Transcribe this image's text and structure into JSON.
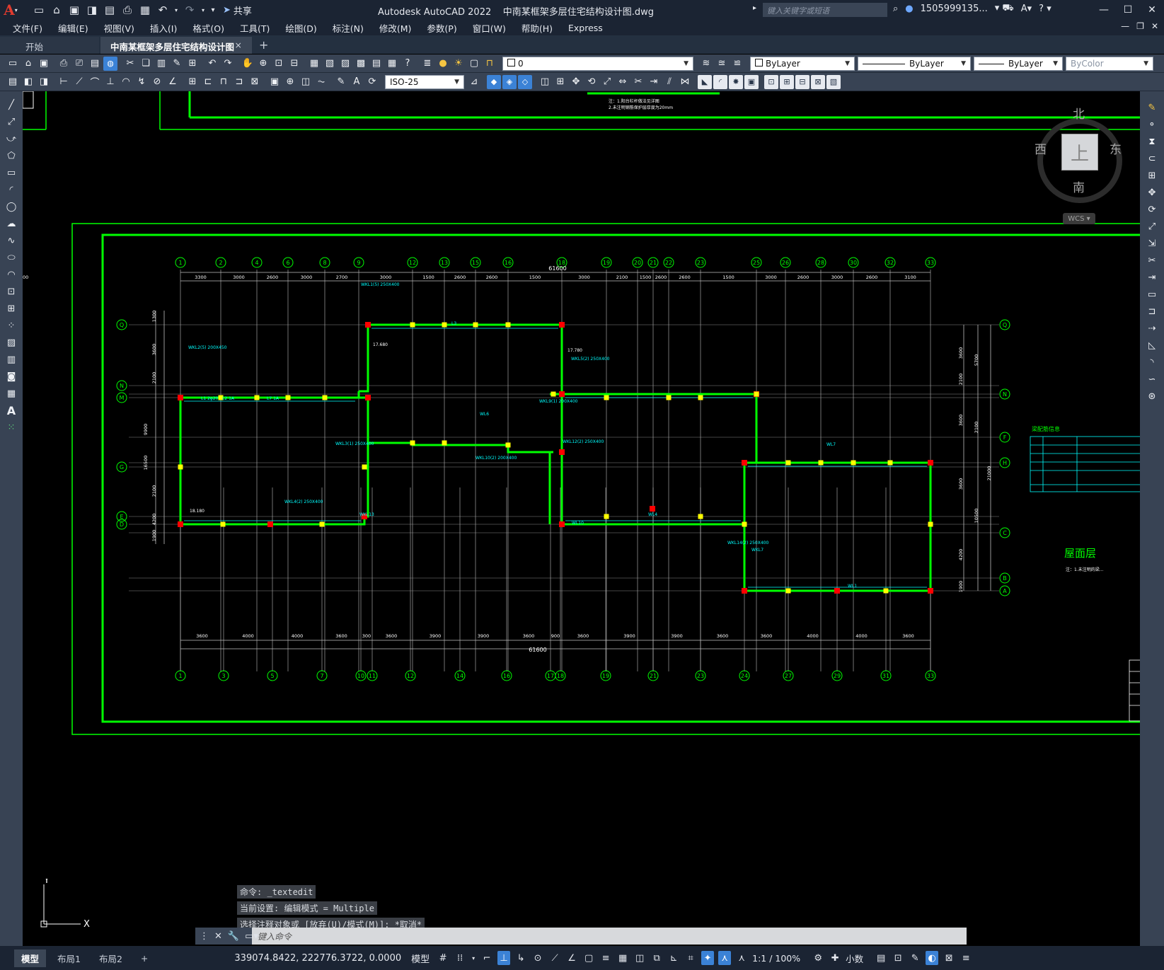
{
  "titlebar": {
    "app_logo": "A",
    "window_title": "Autodesk AutoCAD 2022    中南某框架多层住宅结构设计图.dwg",
    "share_label": "共享",
    "search_placeholder": "键入关键字或短语",
    "user": "1505999135...",
    "controls": [
      "—",
      "☐",
      "✕"
    ]
  },
  "menu": {
    "items": [
      "文件(F)",
      "编辑(E)",
      "视图(V)",
      "插入(I)",
      "格式(O)",
      "工具(T)",
      "绘图(D)",
      "标注(N)",
      "修改(M)",
      "参数(P)",
      "窗口(W)",
      "帮助(H)",
      "Express"
    ]
  },
  "filetabs": {
    "start": "开始",
    "active": "中南某框架多层住宅结构设计图*",
    "close": "×",
    "plus": "+"
  },
  "toolbar": {
    "layer_name": "0",
    "color": "ByLayer",
    "linetype": "ByLayer",
    "lineweight": "ByLayer",
    "plotstyle": "ByColor",
    "dimstyle": "ISO-25"
  },
  "viewcube": {
    "north": "北",
    "south": "南",
    "east": "东",
    "west": "西",
    "face": "上",
    "wcs": "WCS"
  },
  "drawing": {
    "top_note_1": "注：1.阳台栏杆做法见详图",
    "top_note_2": "2.未注明钢筋保护层厚度为20mm",
    "overall_dim_top": "61600",
    "overall_dim_bottom": "61600",
    "top_axes": [
      "1",
      "2",
      "4",
      "6",
      "8",
      "9",
      "12",
      "13",
      "15",
      "16",
      "18",
      "19",
      "20",
      "21",
      "22",
      "23",
      "25",
      "26",
      "28",
      "30",
      "32",
      "33"
    ],
    "bottom_axes": [
      "1",
      "3",
      "5",
      "7",
      "10",
      "11",
      "12",
      "14",
      "16",
      "17",
      "18",
      "19",
      "21",
      "23",
      "24",
      "27",
      "29",
      "31",
      "33"
    ],
    "top_dims": [
      "3300",
      "3000",
      "2600",
      "3000",
      "2700",
      "3000",
      "1500",
      "2600",
      "2600",
      "1500",
      "3000",
      "2100",
      "1500",
      "2600",
      "2600",
      "1500",
      "3000",
      "2600",
      "3000",
      "2600",
      "3100",
      "3300"
    ],
    "bottom_dims": [
      "3600",
      "4000",
      "4000",
      "3600",
      "300",
      "3600",
      "3900",
      "3900",
      "3600",
      "900",
      "3600",
      "3900",
      "3900",
      "3600",
      "3600",
      "4000",
      "4000",
      "3600"
    ],
    "left_axes": [
      "Q",
      "N",
      "M",
      "G",
      "E",
      "D"
    ],
    "right_axes": [
      "Q",
      "N",
      "F",
      "H",
      "C",
      "B",
      "A"
    ],
    "left_dims": [
      "1300",
      "3600",
      "2100",
      "9900",
      "16500",
      "2100",
      "4200",
      "1900"
    ],
    "right_dims": [
      "3600",
      "5700",
      "2100",
      "3600",
      "21000",
      "2100",
      "3600",
      "10500",
      "4200",
      "1900"
    ],
    "beam_labels": [
      "WKL2(5) 200X450",
      "WKL1(5) 250X400",
      "WKL5(2) 250X400",
      "WKL4(2) 250X400",
      "WKL3(1) 250X400",
      "WKL9(1) 200X400",
      "WKL10(2) 200X400",
      "WKL12(2) 250X400",
      "WKL14(2) 250X400",
      "L1 2φ20",
      "L2 1A",
      "L7 1A",
      "L3",
      "WL6",
      "WL7",
      "WL4",
      "WL1",
      "WL10",
      "WKL13",
      "WKL7"
    ],
    "elev_labels": [
      "17.680",
      "17.780",
      "18.180"
    ],
    "right_title": "屋面层",
    "right_table_title": "梁配筋信息",
    "right_note": "注：1.未注明的梁..."
  },
  "command": {
    "history": [
      "命令: _textedit",
      "当前设置: 编辑模式 = Multiple",
      "选择注释对象或 [放弃(U)/模式(M)]: *取消*"
    ],
    "placeholder": "键入命令"
  },
  "statusbar": {
    "layout_tabs": [
      "模型",
      "布局1",
      "布局2"
    ],
    "add": "+",
    "coordinates": "339074.8422, 222776.3722, 0.0000",
    "model": "模型",
    "scale": "1:1 / 100%",
    "units": "小数"
  },
  "colors": {
    "chrome_dark": "#1b2433",
    "toolbar": "#384354",
    "drawing_green": "#00ff00",
    "drawing_cyan": "#00ffff",
    "column_red": "#ff0000",
    "column_yellow": "#ffff00",
    "accent_blue": "#3b82d6"
  }
}
